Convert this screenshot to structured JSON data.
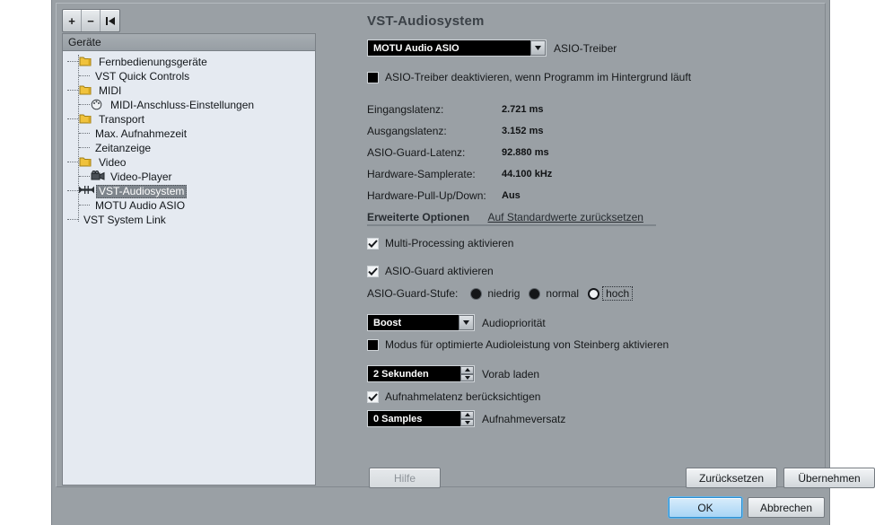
{
  "toolbar": {
    "add_label": "+",
    "remove_label": "−",
    "reset_label": "reset-icon"
  },
  "tree": {
    "header": "Geräte",
    "selected": "VST-Audiosystem",
    "items": [
      {
        "label": "Fernbedienungsgeräte",
        "icon": "folder-icon",
        "depth": 1
      },
      {
        "label": "VST Quick Controls",
        "icon": "none",
        "depth": 2
      },
      {
        "label": "MIDI",
        "icon": "folder-icon",
        "depth": 1
      },
      {
        "label": "MIDI-Anschluss-Einstellungen",
        "icon": "midi-port-icon",
        "depth": 2
      },
      {
        "label": "Transport",
        "icon": "folder-icon",
        "depth": 1
      },
      {
        "label": "Max. Aufnahmezeit",
        "icon": "none",
        "depth": 2
      },
      {
        "label": "Zeitanzeige",
        "icon": "none",
        "depth": 2
      },
      {
        "label": "Video",
        "icon": "folder-icon",
        "depth": 1
      },
      {
        "label": "Video-Player",
        "icon": "video-camera-icon",
        "depth": 2
      },
      {
        "label": "VST-Audiosystem",
        "icon": "audio-system-icon",
        "depth": 1
      },
      {
        "label": "MOTU Audio ASIO",
        "icon": "none",
        "depth": 2
      },
      {
        "label": "VST System Link",
        "icon": "none",
        "depth": 1
      }
    ]
  },
  "pane": {
    "title": "VST-Audiosystem",
    "driver": {
      "value": "MOTU Audio ASIO",
      "label": "ASIO-Treiber"
    },
    "release_driver": {
      "label": "ASIO-Treiber deaktivieren, wenn Programm im Hintergrund läuft",
      "checked": false
    },
    "latency": [
      {
        "label": "Eingangslatenz:",
        "value": "2.721 ms"
      },
      {
        "label": "Ausgangslatenz:",
        "value": "3.152 ms"
      },
      {
        "label": "ASIO-Guard-Latenz:",
        "value": "92.880 ms"
      },
      {
        "label": "Hardware-Samplerate:",
        "value": "44.100 kHz"
      },
      {
        "label": "Hardware-Pull-Up/Down:",
        "value": "Aus"
      }
    ],
    "advanced": {
      "title": "Erweiterte Optionen",
      "reset_link": "Auf Standardwerte zurücksetzen"
    },
    "multi_processing": {
      "label": "Multi-Processing aktivieren",
      "checked": true
    },
    "asio_guard": {
      "label": "ASIO-Guard aktivieren",
      "checked": true
    },
    "asio_guard_level": {
      "label": "ASIO-Guard-Stufe:",
      "options": [
        {
          "label": "niedrig",
          "selected": false
        },
        {
          "label": "normal",
          "selected": false
        },
        {
          "label": "hoch",
          "selected": true
        }
      ]
    },
    "audio_priority": {
      "value": "Boost",
      "label": "Audiopriorität"
    },
    "steinberg_mode": {
      "label": "Modus für optimierte Audioleistung von Steinberg aktivieren",
      "checked": false
    },
    "preload": {
      "value": "2 Sekunden",
      "label": "Vorab laden"
    },
    "adjust_latency": {
      "label": "Aufnahmelatenz berücksichtigen",
      "checked": true
    },
    "record_shift": {
      "value": "0 Samples",
      "label": "Aufnahmeversatz"
    }
  },
  "buttons": {
    "help": "Hilfe",
    "reset": "Zurücksetzen",
    "apply": "Übernehmen",
    "ok": "OK",
    "cancel": "Abbrechen"
  },
  "colors": {
    "dialog_bg": "#9aa0a5",
    "tree_bg": "#e5eaf1",
    "field_bg": "#000000",
    "field_fg": "#ffffff",
    "selection_bg": "#7e858c",
    "default_button": "#a8d5f5"
  }
}
